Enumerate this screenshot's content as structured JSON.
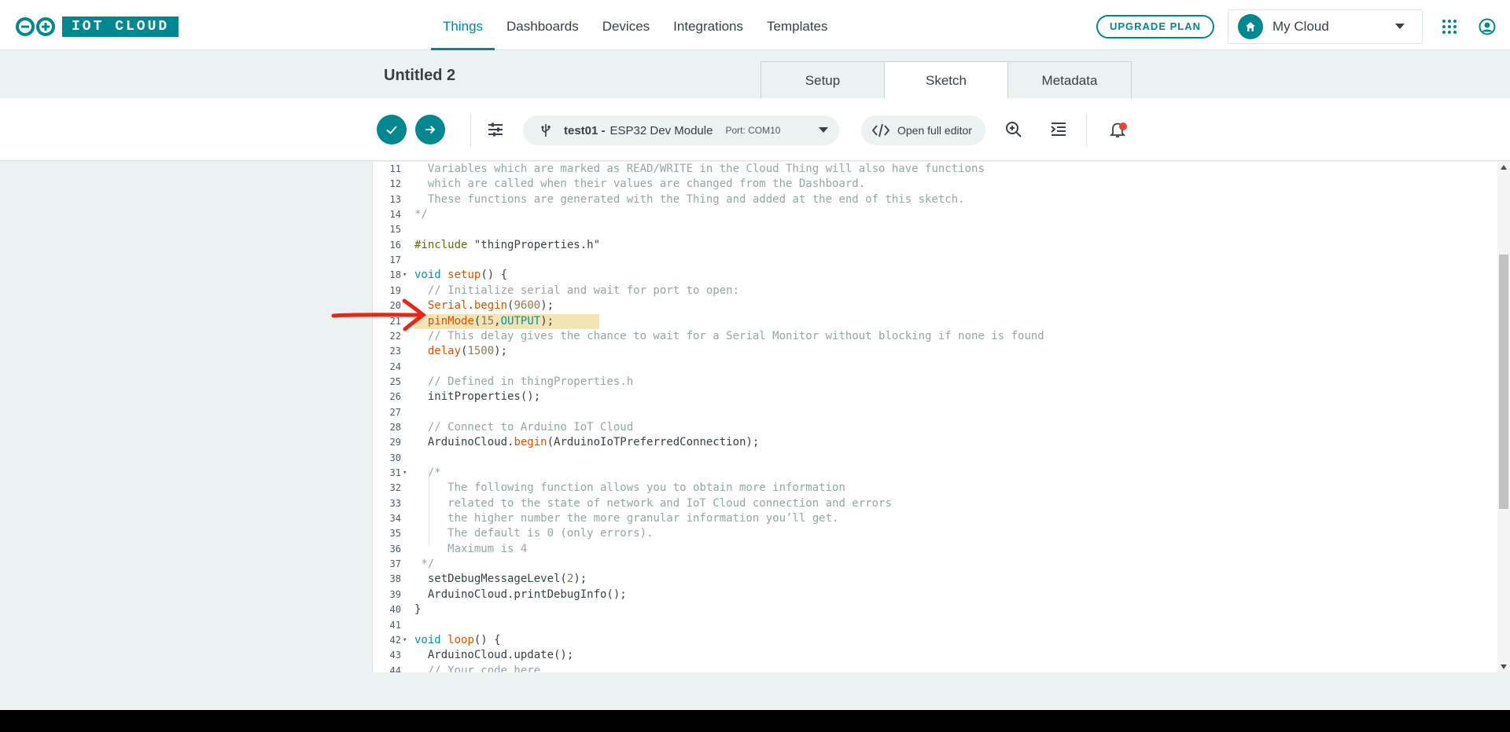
{
  "app": {
    "brand": "IOT CLOUD",
    "accent_color": "#00878f"
  },
  "nav": {
    "items": [
      {
        "label": "Things",
        "active": true
      },
      {
        "label": "Dashboards"
      },
      {
        "label": "Devices"
      },
      {
        "label": "Integrations"
      },
      {
        "label": "Templates"
      }
    ]
  },
  "header": {
    "upgrade_label": "UPGRADE PLAN",
    "cloud_selector": "My Cloud"
  },
  "thing": {
    "title": "Untitled 2",
    "tabs": [
      {
        "label": "Setup"
      },
      {
        "label": "Sketch",
        "active": true
      },
      {
        "label": "Metadata"
      }
    ]
  },
  "toolbar": {
    "board_name": "test01 -",
    "board_model": "ESP32 Dev Module",
    "port": "Port: COM10",
    "open_editor_label": "Open full editor"
  },
  "editor": {
    "highlighted_line": 21,
    "lines": [
      {
        "n": "11",
        "text": "  Variables which are marked as READ/WRITE in the Cloud Thing will also have functions"
      },
      {
        "n": "12",
        "text": "  which are called when their values are changed from the Dashboard."
      },
      {
        "n": "13",
        "text": "  These functions are generated with the Thing and added at the end of this sketch."
      },
      {
        "n": "14",
        "text": "*/"
      },
      {
        "n": "15",
        "text": ""
      },
      {
        "n": "16",
        "text": "#include \"thingProperties.h\""
      },
      {
        "n": "17",
        "text": ""
      },
      {
        "n": "18",
        "text": "void setup() {"
      },
      {
        "n": "19",
        "text": "  // Initialize serial and wait for port to open:"
      },
      {
        "n": "20",
        "text": "  Serial.begin(9600);"
      },
      {
        "n": "21",
        "text": "  pinMode(15,OUTPUT);"
      },
      {
        "n": "22",
        "text": "  // This delay gives the chance to wait for a Serial Monitor without blocking if none is found"
      },
      {
        "n": "23",
        "text": "  delay(1500);"
      },
      {
        "n": "24",
        "text": ""
      },
      {
        "n": "25",
        "text": "  // Defined in thingProperties.h"
      },
      {
        "n": "26",
        "text": "  initProperties();"
      },
      {
        "n": "27",
        "text": ""
      },
      {
        "n": "28",
        "text": "  // Connect to Arduino IoT Cloud"
      },
      {
        "n": "29",
        "text": "  ArduinoCloud.begin(ArduinoIoTPreferredConnection);"
      },
      {
        "n": "30",
        "text": ""
      },
      {
        "n": "31",
        "text": "  /*"
      },
      {
        "n": "32",
        "text": "     The following function allows you to obtain more information"
      },
      {
        "n": "33",
        "text": "     related to the state of network and IoT Cloud connection and errors"
      },
      {
        "n": "34",
        "text": "     the higher number the more granular information you’ll get."
      },
      {
        "n": "35",
        "text": "     The default is 0 (only errors)."
      },
      {
        "n": "36",
        "text": "     Maximum is 4"
      },
      {
        "n": "37",
        "text": " */"
      },
      {
        "n": "38",
        "text": "  setDebugMessageLevel(2);"
      },
      {
        "n": "39",
        "text": "  ArduinoCloud.printDebugInfo();"
      },
      {
        "n": "40",
        "text": "}"
      },
      {
        "n": "41",
        "text": ""
      },
      {
        "n": "42",
        "text": "void loop() {"
      },
      {
        "n": "43",
        "text": "  ArduinoCloud.update();"
      },
      {
        "n": "44",
        "text": "  // Your code here"
      }
    ]
  }
}
